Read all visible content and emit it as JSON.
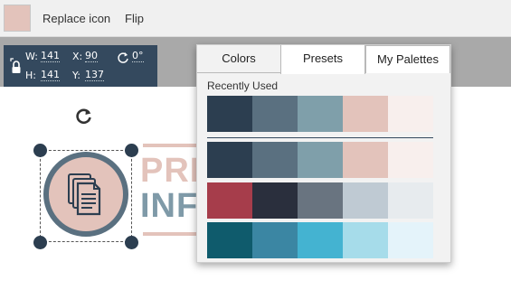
{
  "toolbar": {
    "swatch_color": "#e3c3bb",
    "replace_icon_label": "Replace icon",
    "flip_label": "Flip"
  },
  "geometry": {
    "w_label": "W:",
    "w_value": "141",
    "x_label": "X:",
    "x_value": "90",
    "h_label": "H:",
    "h_value": "141",
    "y_label": "Y:",
    "y_value": "137",
    "rotation_value": "0°"
  },
  "logo": {
    "line1": "PRE",
    "line2": "INF",
    "line1_color": "#e3c3bb",
    "line2_color": "#7f9aa8"
  },
  "color_panel": {
    "tabs": [
      {
        "label": "Colors"
      },
      {
        "label": "Presets"
      },
      {
        "label": "My Palettes"
      }
    ],
    "active_tab": "Presets",
    "recently_used_label": "Recently Used",
    "recent_palette": [
      "#2c3e50",
      "#5a7080",
      "#7f9faa",
      "#e3c3bb",
      "#f8efed"
    ],
    "preset_palettes": [
      [
        "#2c3e50",
        "#5a7080",
        "#7f9faa",
        "#e3c3bb",
        "#f8efed"
      ],
      [
        "#a63d4b",
        "#2a2f3d",
        "#697480",
        "#bfcad3",
        "#e7ebee"
      ],
      [
        "#0f5b6c",
        "#3b86a3",
        "#44b3d1",
        "#a6dcea",
        "#e4f3fa"
      ]
    ]
  }
}
